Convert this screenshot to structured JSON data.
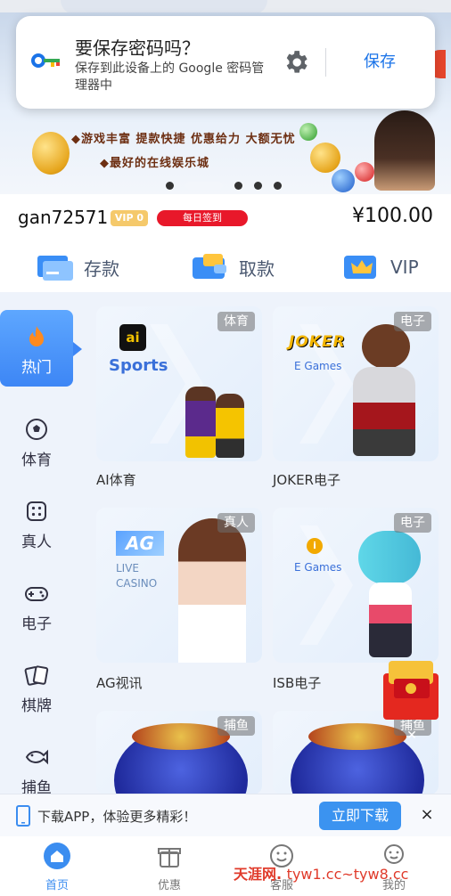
{
  "popup": {
    "title": "要保存密码吗？",
    "body": "保存到此设备上的 Google 密码管理器中",
    "save_label": "保存",
    "key_icon": "key-icon",
    "gear_icon": "gear-icon"
  },
  "banner": {
    "line1": "◆游戏丰富 提款快捷 优惠给力 大额无忧",
    "line2": "◆最好的在线娱乐城",
    "dots": 5,
    "active_dot": 0
  },
  "user": {
    "name": "gan72571",
    "vip": "VIP 0",
    "signin": "每日签到",
    "balance": "¥100.00"
  },
  "actions": [
    {
      "label": "存款",
      "icon": "card-icon"
    },
    {
      "label": "取款",
      "icon": "wallet-icon"
    },
    {
      "label": "VIP",
      "icon": "crown-icon"
    }
  ],
  "sidebar": {
    "items": [
      {
        "label": "热门",
        "icon": "flame-icon",
        "active": true
      },
      {
        "label": "体育",
        "icon": "soccer-ball-icon"
      },
      {
        "label": "真人",
        "icon": "dice-icon"
      },
      {
        "label": "电子",
        "icon": "gamepad-icon"
      },
      {
        "label": "棋牌",
        "icon": "cards-icon"
      },
      {
        "label": "捕鱼",
        "icon": "fish-icon"
      }
    ]
  },
  "cards": [
    {
      "name": "AI体育",
      "tag": "体育",
      "brand": "Sports",
      "logo": "ai"
    },
    {
      "name": "JOKER电子",
      "tag": "电子",
      "brand": "E Games",
      "logo": "JOKER"
    },
    {
      "name": "AG视讯",
      "tag": "真人",
      "brand": "LIVE CASINO",
      "logo": "AG"
    },
    {
      "name": "ISB电子",
      "tag": "电子",
      "brand": "E Games",
      "logo": "ISB"
    },
    {
      "name": "",
      "tag": "捕鱼"
    },
    {
      "name": "",
      "tag": "捕鱼"
    }
  ],
  "download_bar": {
    "text": "下载APP，体验更多精彩！",
    "button": "立即下载",
    "close": "×"
  },
  "tabbar": {
    "items": [
      {
        "label": "首页",
        "icon": "home-icon",
        "active": true
      },
      {
        "label": "优惠",
        "icon": "gift-icon"
      },
      {
        "label": "客服",
        "icon": "smile-icon"
      },
      {
        "label": "我的",
        "icon": "profile-icon"
      }
    ]
  },
  "watermark": {
    "cn": "天涯网",
    "url": "tyw1.cc~tyw8.cc"
  },
  "colors": {
    "accent": "#3b8df0",
    "signin": "#e8182a",
    "vip": "#f5c96b",
    "google_blue": "#1a73e8"
  }
}
